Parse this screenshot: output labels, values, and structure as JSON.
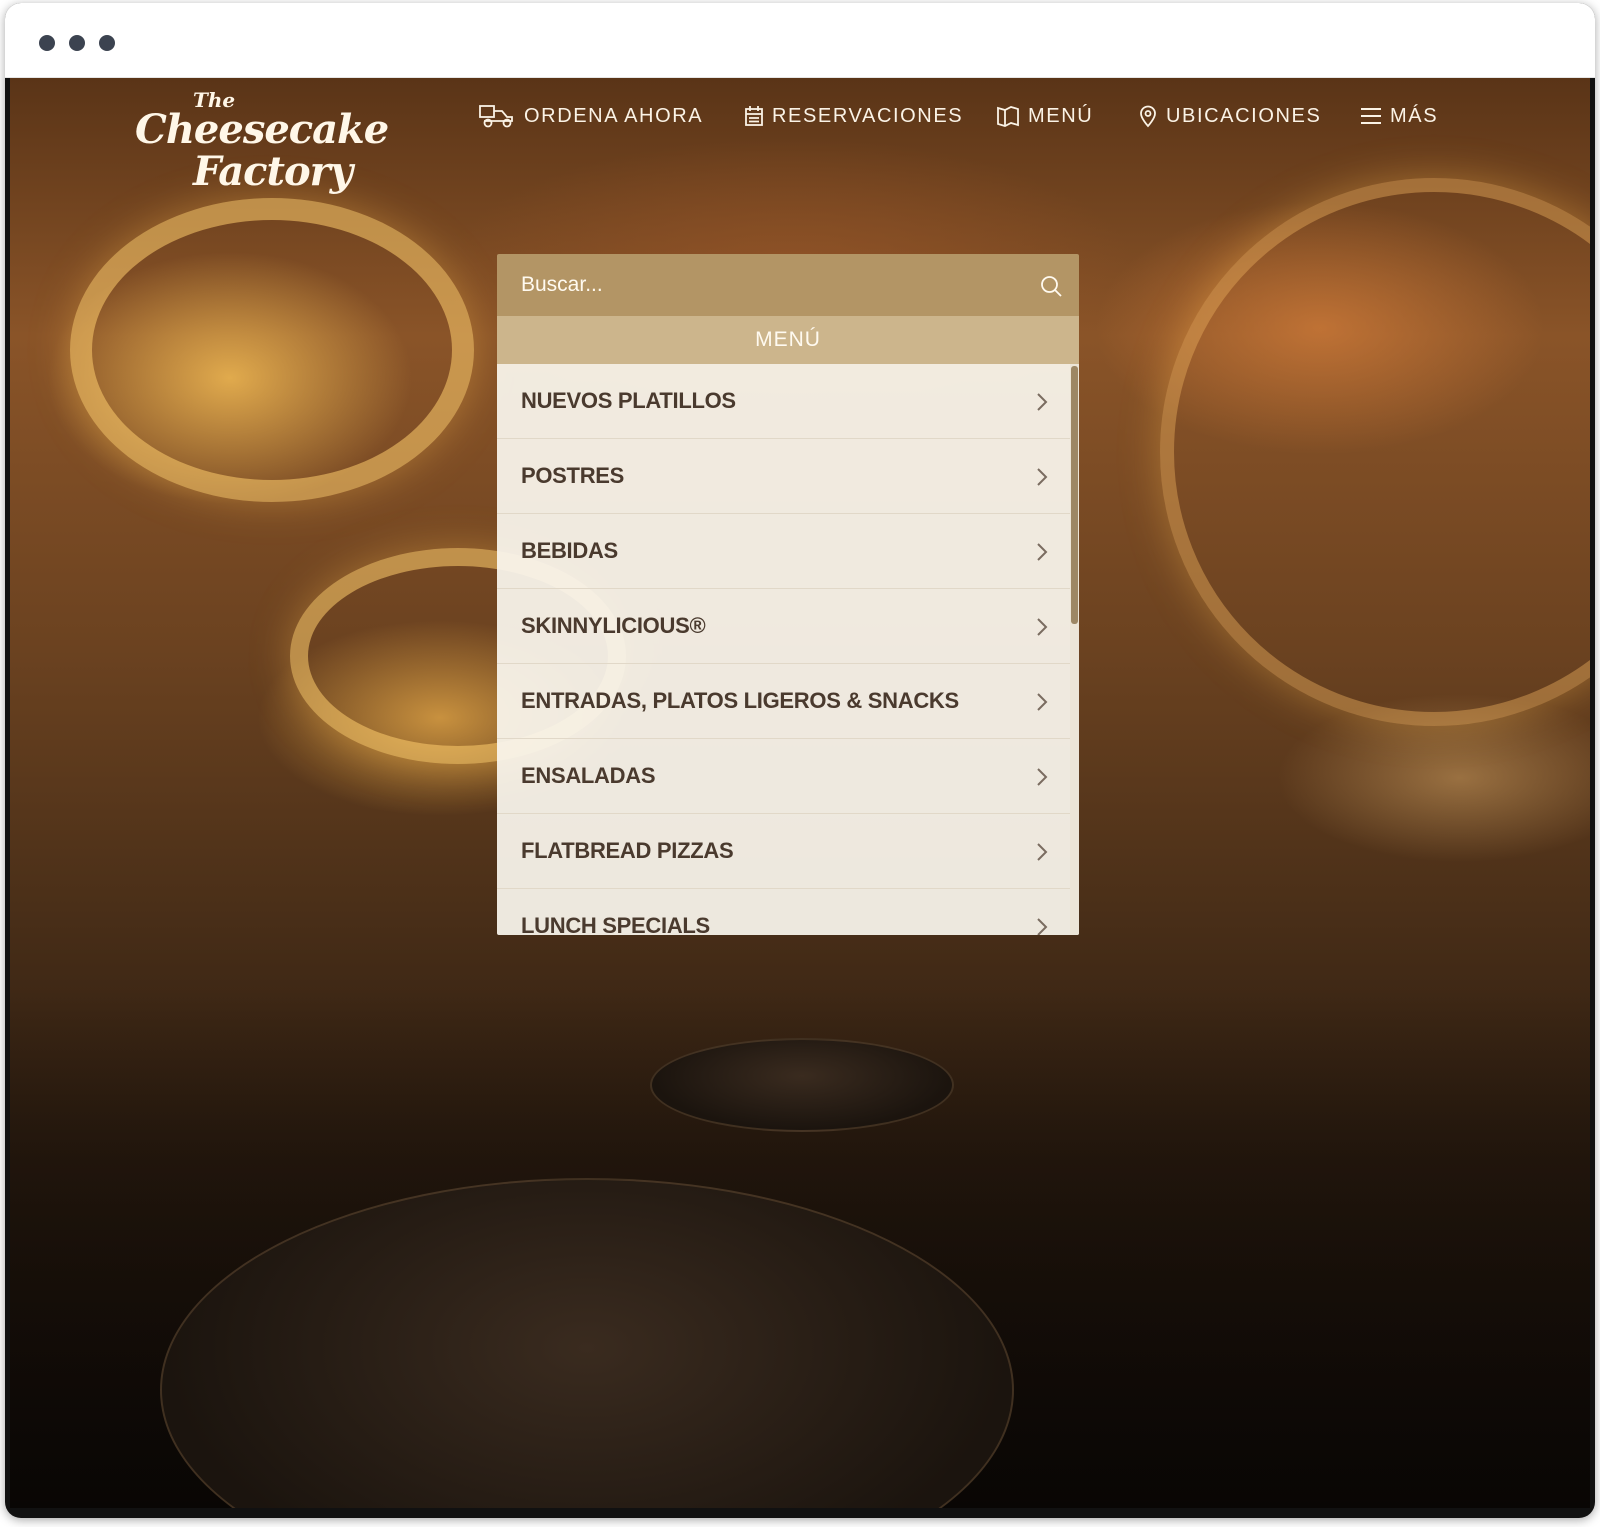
{
  "browser": {
    "window_controls": [
      "dot",
      "dot",
      "dot"
    ]
  },
  "logo": {
    "the": "The",
    "line1": "Cheesecake",
    "line2": "Factory"
  },
  "nav": {
    "items": [
      {
        "label": "ORDENA AHORA",
        "icon": "delivery-scooter-icon"
      },
      {
        "label": "RESERVACIONES",
        "icon": "calendar-icon"
      },
      {
        "label": "MENÚ",
        "icon": "book-open-icon"
      },
      {
        "label": "UBICACIONES",
        "icon": "map-pin-icon"
      },
      {
        "label": "MÁS",
        "icon": "hamburger-menu-icon"
      }
    ]
  },
  "search": {
    "placeholder": "Buscar...",
    "icon": "search-icon"
  },
  "menu": {
    "header": "MENÚ",
    "items": [
      {
        "label": "NUEVOS PLATILLOS"
      },
      {
        "label": "POSTRES"
      },
      {
        "label": "BEBIDAS"
      },
      {
        "label": "SKINNYLICIOUS®"
      },
      {
        "label": "ENTRADAS, PLATOS LIGEROS & SNACKS"
      },
      {
        "label": "ENSALADAS"
      },
      {
        "label": "FLATBREAD PIZZAS"
      },
      {
        "label": "LUNCH SPECIALS"
      }
    ]
  },
  "colors": {
    "search_bar": "#b39565",
    "menu_header": "#ccb58c",
    "menu_text": "#4a3a2e"
  }
}
